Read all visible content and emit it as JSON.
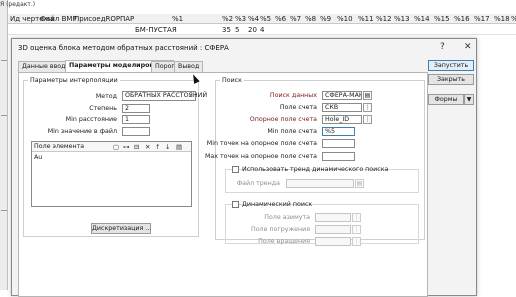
{
  "spreadsheet": {
    "left_tab": "Я (редакт.)",
    "headers": [
      "Ид чертежа",
      "Файл ВМР",
      "ПрисоедROP",
      "ПАР",
      "%1",
      "%2",
      "%3",
      "%4",
      "%5",
      "%6",
      "%7",
      "%8",
      "%9",
      "%10",
      "%11",
      "%12",
      "%13",
      "%14",
      "%15",
      "%16",
      "%17",
      "%18",
      "%19",
      "%"
    ],
    "row": [
      "",
      "",
      "",
      "",
      "БМ-ПУСТАЯ",
      "35",
      "5",
      "20",
      "4"
    ]
  },
  "dialog": {
    "title": "3D оценка блока методом обратных расстояний : СФЕРА",
    "help_button": "?",
    "close_button": "✕",
    "tabs": [
      "Данные ввода",
      "Параметры моделирования",
      "Порог",
      "Вывод"
    ],
    "active_tab": "Параметры моделирования",
    "interpolation": {
      "legend": "Параметры интерполяции",
      "method_label": "Метод",
      "method_value": "ОБРАТНЫХ РАССТОЯНИЙ",
      "power_label": "Степень",
      "power_value": "2",
      "min_distance_label": "Min расстояние",
      "min_distance_value": "1",
      "min_file_value_label": "Min значение в файл",
      "min_file_value_value": "",
      "field_list_title": "Поле элемента",
      "field_list_items": [
        "Au"
      ],
      "discretization_button": "Дискретизация ..."
    },
    "search": {
      "legend": "Поиск",
      "search_data_label": "Поиск данных",
      "search_data_value": "СФЕРА-МАК",
      "account_field_label": "Поле счета",
      "account_field_value": "СКВ",
      "ref_account_field_label": "Опорное поле счета",
      "ref_account_field_value": "Hole_ID",
      "min_account_field_label": "Min поле счета",
      "min_account_field_value": "%5",
      "min_points_ref_label": "Min точек на опорное поле счета",
      "min_points_ref_value": "",
      "max_points_ref_label": "Max точек на опорное поле счета",
      "max_points_ref_value": "",
      "trend_checkbox_label": "Использовать тренд динамического поиска",
      "trend_file_label": "Файл тренда",
      "trend_file_value": "",
      "dynamic_checkbox_label": "Динамический поиск",
      "azimuth_field_label": "Поле азимута",
      "dip_field_label": "Поле погружения",
      "rotation_field_label": "Поле вращения"
    },
    "buttons": {
      "run": "Запустить",
      "close": "Закрыть",
      "forms": "Формы",
      "forms_dropdown": "▼"
    }
  }
}
